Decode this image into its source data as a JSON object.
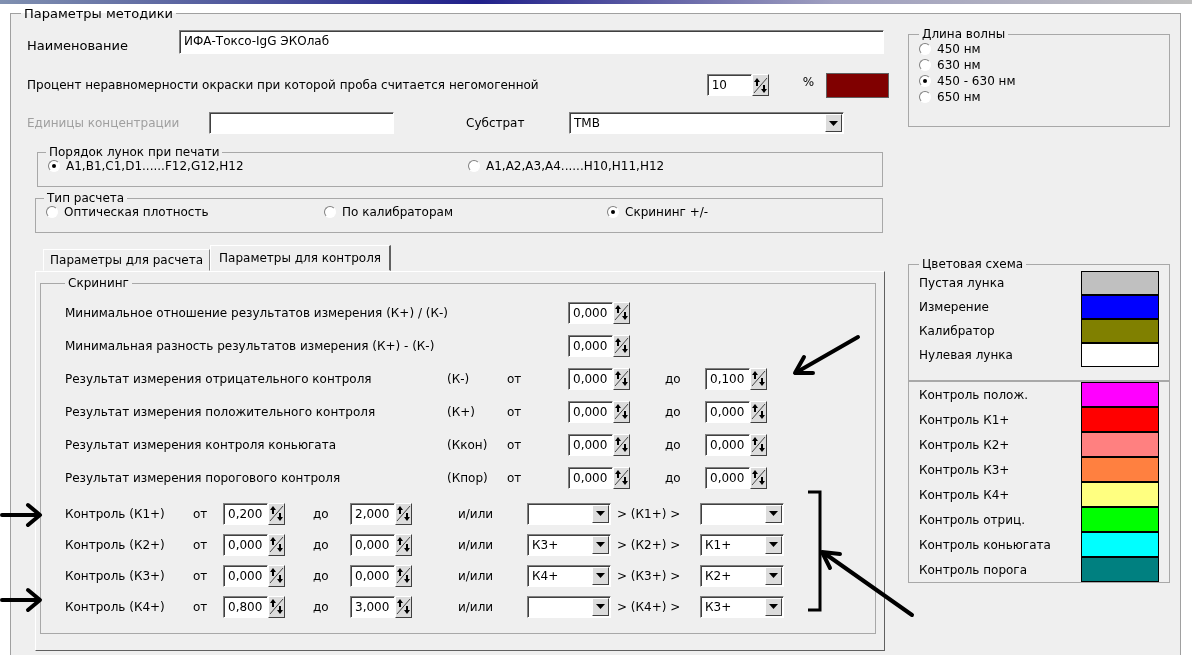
{
  "group_title": "Параметры методики",
  "name": {
    "label": "Наименование",
    "value": "ИФА-Токсо-IgG ЭКОлаб"
  },
  "nonuniformity": {
    "label": "Процент неравномерности окраски при которой проба считается негомогенной",
    "value": "10",
    "unit": "%",
    "color": "#800000"
  },
  "units": {
    "label": "Единицы концентрации",
    "disabled": true
  },
  "substrate": {
    "label": "Субстрат",
    "value": "ТМВ"
  },
  "well_order": {
    "title": "Порядок лунок при печати",
    "options": [
      {
        "label": "A1,B1,C1,D1......F12,G12,H12",
        "selected": true
      },
      {
        "label": "A1,A2,A3,A4......H10,H11,H12",
        "selected": false
      }
    ]
  },
  "calc_type": {
    "title": "Тип расчета",
    "options": [
      {
        "label": "Оптическая плотность",
        "selected": false
      },
      {
        "label": "По калибраторам",
        "selected": false
      },
      {
        "label": "Скрининг +/-",
        "selected": true
      }
    ]
  },
  "tabs": [
    {
      "label": "Параметры для расчета",
      "selected": false
    },
    {
      "label": "Параметры для контроля",
      "selected": true
    }
  ],
  "screening": {
    "title": "Скрининг",
    "rows": [
      {
        "kind": "single",
        "label": "Минимальное отношение  результатов измерения  (К+) / (К-)",
        "from": "0,000"
      },
      {
        "kind": "single",
        "label": "Минимальная разность   результатов измерения  (К+) - (К-)",
        "from": "0,000"
      },
      {
        "kind": "range",
        "label": "Результат измерения  отрицательного контроля",
        "tag": "(К-)",
        "from_label": "от",
        "from": "0,000",
        "to_label": "до",
        "to": "0,100"
      },
      {
        "kind": "range",
        "label": "Результат измерения  положительного контроля",
        "tag": "(К+)",
        "from_label": "от",
        "from": "0,000",
        "to_label": "до",
        "to": "0,000"
      },
      {
        "kind": "range",
        "label": "Результат измерения контроля  коньюгата",
        "tag": "(Ккон)",
        "from_label": "от",
        "from": "0,000",
        "to_label": "до",
        "to": "0,000"
      },
      {
        "kind": "range",
        "label": "Результат измерения  порогового  контроля",
        "tag": "(Кпор)",
        "from_label": "от",
        "from": "0,000",
        "to_label": "до",
        "to": "0,000"
      },
      {
        "kind": "control",
        "label": "Контроль  (К1+)",
        "from_label": "от",
        "from": "0,200",
        "to_label": "до",
        "to": "2,000",
        "or_label": "и/или",
        "middle": "> (К1+) >"
      },
      {
        "kind": "control",
        "label": "Контроль  (К2+)",
        "from_label": "от",
        "from": "0,000",
        "to_label": "до",
        "to": "0,000",
        "or_label": "и/или",
        "left": "К3+",
        "middle": "> (К2+) >",
        "right": "К1+"
      },
      {
        "kind": "control",
        "label": "Контроль  (К3+)",
        "from_label": "от",
        "from": "0,000",
        "to_label": "до",
        "to": "0,000",
        "or_label": "и/или",
        "left": "К4+",
        "middle": "> (К3+) >",
        "right": "К2+"
      },
      {
        "kind": "control",
        "label": "Контроль  (К4+)",
        "from_label": "от",
        "from": "0,800",
        "to_label": "до",
        "to": "3,000",
        "or_label": "и/или",
        "middle": "> (К4+) >",
        "right": "К3+"
      }
    ]
  },
  "wavelength": {
    "title": "Длина волны",
    "options": [
      {
        "label": "450 нм",
        "selected": false
      },
      {
        "label": "630 нм",
        "selected": false
      },
      {
        "label": "450 - 630 нм",
        "selected": true
      },
      {
        "label": "650 нм",
        "selected": false
      }
    ]
  },
  "color_scheme": {
    "title": "Цветовая схема",
    "items": [
      {
        "label": "Пустая лунка",
        "color": "#c0c0c0"
      },
      {
        "label": "Измерение",
        "color": "#0000ff"
      },
      {
        "label": "Калибратор",
        "color": "#808000"
      },
      {
        "label": "Нулевая лунка",
        "color": "#ffffff"
      }
    ]
  },
  "control_colors": [
    {
      "label": "Контроль полож.",
      "color": "#ff00ff"
    },
    {
      "label": "Контроль К1+",
      "color": "#ff0000"
    },
    {
      "label": "Контроль К2+",
      "color": "#ff8080"
    },
    {
      "label": "Контроль К3+",
      "color": "#ff8040"
    },
    {
      "label": "Контроль К4+",
      "color": "#ffff80"
    },
    {
      "label": "Контроль отриц.",
      "color": "#00ff00"
    },
    {
      "label": "Контроль коньюгата",
      "color": "#00ffff"
    },
    {
      "label": "Контроль порога",
      "color": "#008080"
    }
  ]
}
